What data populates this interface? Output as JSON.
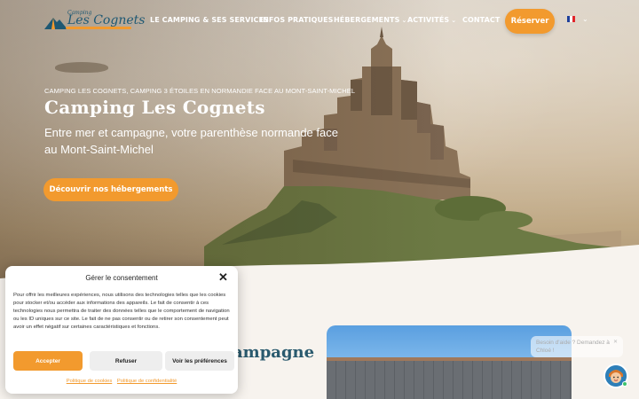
{
  "header": {
    "logo_small": "Camping",
    "logo_main": "Les Cognets",
    "nav": [
      {
        "label": "LE CAMPING & SES SERVICES",
        "dropdown": false
      },
      {
        "label": "INFOS PRATIQUES",
        "dropdown": false
      },
      {
        "label": "HÉBERGEMENTS",
        "dropdown": true
      },
      {
        "label": "ACTIVITÉS",
        "dropdown": true
      },
      {
        "label": "CONTACT",
        "dropdown": false
      }
    ],
    "cta_label": "Réserver",
    "language": "fr"
  },
  "hero": {
    "kicker": "CAMPING LES COGNETS, CAMPING 3 ÉTOILES EN NORMANDIE FACE AU MONT-SAINT-MICHEL",
    "title": "Camping Les Cognets",
    "subtitle": "Entre mer et campagne, votre parenthèse normande face au Mont-Saint-Michel",
    "cta_label": "Découvrir nos hébergements"
  },
  "section": {
    "heading_partial": "ampagne"
  },
  "chat": {
    "prompt": "Besoin d'aide ? Demandez à Chloé !",
    "close_icon": "close-icon"
  },
  "consent": {
    "title": "Gérer le consentement",
    "body": "Pour offrir les meilleures expériences, nous utilisons des technologies telles que les cookies pour stocker et/ou accéder aux informations des appareils. Le fait de consentir à ces technologies nous permettra de traiter des données telles que le comportement de navigation ou les ID uniques sur ce site. Le fait de ne pas consentir ou de retirer son consentement peut avoir un effet négatif sur certaines caractéristiques et fonctions.",
    "accept_label": "Accepter",
    "refuse_label": "Refuser",
    "prefs_label": "Voir les préférences",
    "cookie_policy_label": "Politique de cookies",
    "privacy_policy_label": "Politique de confidentialité"
  },
  "colors": {
    "accent": "#f29a2e",
    "brand": "#1e5873",
    "heading": "#2a5a6e"
  }
}
